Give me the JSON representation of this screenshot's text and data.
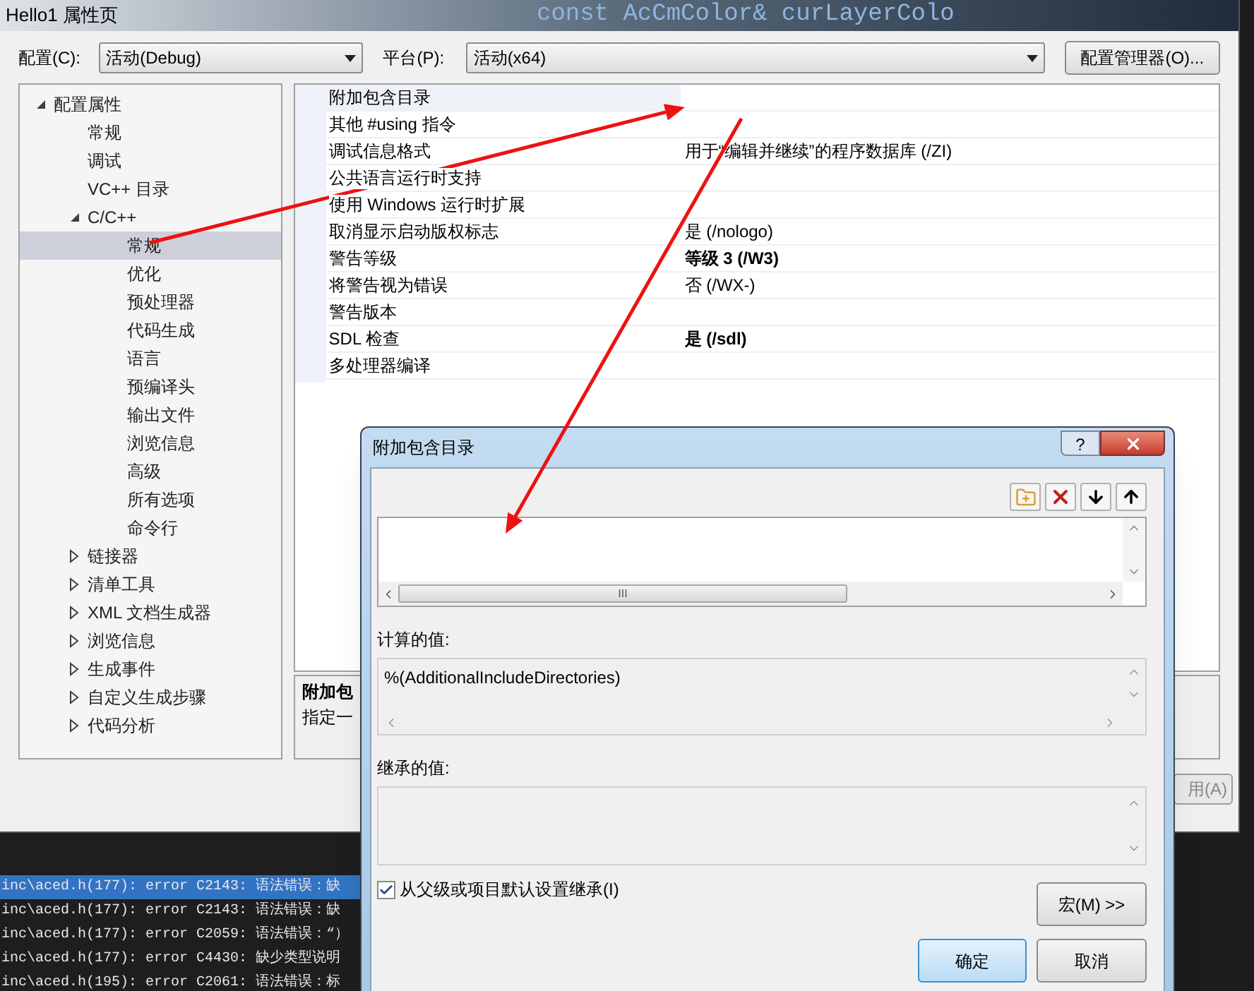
{
  "background_code": "const AcCmColor& curLayerColo",
  "window": {
    "title": "Hello1 属性页"
  },
  "toolbar": {
    "config_label": "配置(C):",
    "config_value": "活动(Debug)",
    "platform_label": "平台(P):",
    "platform_value": "活动(x64)",
    "manager_button": "配置管理器(O)..."
  },
  "tree": [
    {
      "label": "配置属性",
      "expanded": true,
      "selected": false,
      "children": [
        {
          "label": "常规",
          "selected": false
        },
        {
          "label": "调试",
          "selected": false
        },
        {
          "label": "VC++ 目录",
          "selected": false
        },
        {
          "label": "C/C++",
          "expanded": true,
          "selected": false,
          "children": [
            {
              "label": "常规",
              "selected": true
            },
            {
              "label": "优化",
              "selected": false
            },
            {
              "label": "预处理器",
              "selected": false
            },
            {
              "label": "代码生成",
              "selected": false
            },
            {
              "label": "语言",
              "selected": false
            },
            {
              "label": "预编译头",
              "selected": false
            },
            {
              "label": "输出文件",
              "selected": false
            },
            {
              "label": "浏览信息",
              "selected": false
            },
            {
              "label": "高级",
              "selected": false
            },
            {
              "label": "所有选项",
              "selected": false
            },
            {
              "label": "命令行",
              "selected": false
            }
          ]
        },
        {
          "label": "链接器",
          "expanded": false,
          "selected": false
        },
        {
          "label": "清单工具",
          "expanded": false,
          "selected": false
        },
        {
          "label": "XML 文档生成器",
          "expanded": false,
          "selected": false
        },
        {
          "label": "浏览信息",
          "expanded": false,
          "selected": false
        },
        {
          "label": "生成事件",
          "expanded": false,
          "selected": false
        },
        {
          "label": "自定义生成步骤",
          "expanded": false,
          "selected": false
        },
        {
          "label": "代码分析",
          "expanded": false,
          "selected": false
        }
      ]
    }
  ],
  "properties": [
    {
      "name": "附加包含目录"
    },
    {
      "name": "其他 #using 指令"
    },
    {
      "name": "调试信息格式",
      "value": "用于“编辑并继续”的程序数据库 (/ZI)",
      "bold": false
    },
    {
      "name": "公共语言运行时支持"
    },
    {
      "name": "使用 Windows 运行时扩展"
    },
    {
      "name": "取消显示启动版权标志",
      "value": "是 (/nologo)",
      "bold": false
    },
    {
      "name": "警告等级",
      "value": "等级 3 (/W3)",
      "bold": true
    },
    {
      "name": "将警告视为错误",
      "value": "否 (/WX-)",
      "bold": false
    },
    {
      "name": "警告版本"
    },
    {
      "name": "SDL 检查",
      "value": "是 (/sdl)",
      "bold": true
    },
    {
      "name": "多处理器编译"
    }
  ],
  "description": {
    "title": "附加包",
    "text": "指定一"
  },
  "apply_button": "用(A)",
  "output": [
    {
      "text": "inc\\aced.h(177): error C2143: 语法错误：缺",
      "selected": true
    },
    {
      "text": "inc\\aced.h(177): error C2143: 语法错误：缺",
      "selected": false
    },
    {
      "text": "inc\\aced.h(177): error C2059: 语法错误：“）",
      "selected": false
    },
    {
      "text": "inc\\aced.h(177): error C4430: 缺少类型说明",
      "selected": false
    },
    {
      "text": "inc\\aced.h(195): error C2061: 语法错误：标",
      "selected": false
    }
  ],
  "dialog": {
    "title": "附加包含目录",
    "help": "?",
    "computed_label": "计算的值:",
    "computed_value": "%(AdditionalIncludeDirectories)",
    "inherited_label": "继承的值:",
    "inherit_checkbox": {
      "label": "从父级或项目默认设置继承(I)",
      "checked": true
    },
    "macro_button": "宏(M) >>",
    "ok_button": "确定",
    "cancel_button": "取消",
    "scroll_grip": "III"
  }
}
